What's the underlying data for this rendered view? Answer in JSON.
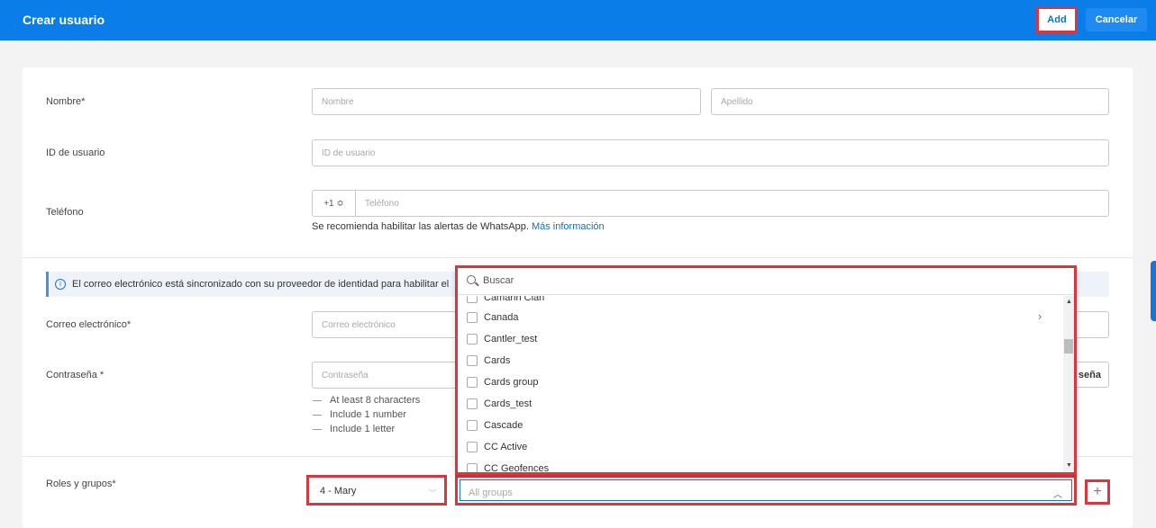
{
  "header": {
    "title": "Crear usuario",
    "add_label": "Add",
    "cancel_label": "Cancelar"
  },
  "form": {
    "name_label": "Nombre*",
    "first_name_placeholder": "Nombre",
    "last_name_placeholder": "Apellido",
    "user_id_label": "ID de usuario",
    "user_id_placeholder": "ID de usuario",
    "phone_label": "Teléfono",
    "phone_prefix": "+1 ≎",
    "phone_placeholder": "Teléfono",
    "phone_help": "Se recomienda habilitar las alertas de WhatsApp.",
    "phone_help_link": "Más información",
    "info_text": "El correo electrónico está sincronizado con su proveedor de identidad para habilitar el",
    "email_label": "Correo electrónico*",
    "email_placeholder": "Correo electrónico",
    "password_label": "Contraseña *",
    "password_placeholder": "Contraseña",
    "generate_label_fragment": "seña",
    "password_rules": [
      "At least 8 characters",
      "Include 1 number",
      "Include 1 letter"
    ],
    "roles_label": "Roles y grupos*",
    "role_value": "4 - Mary",
    "groups_placeholder": "All groups"
  },
  "dropdown": {
    "search_placeholder": "Buscar",
    "items": [
      "Camarin Clan",
      "Canada",
      "Cantler_test",
      "Cards",
      "Cards group",
      "Cards_test",
      "Cascade",
      "CC Active",
      "CC Geofences"
    ]
  },
  "colors": {
    "header_blue": "#0a7de8",
    "highlight_red": "#d9363e",
    "link_blue": "#0a6fd6"
  }
}
